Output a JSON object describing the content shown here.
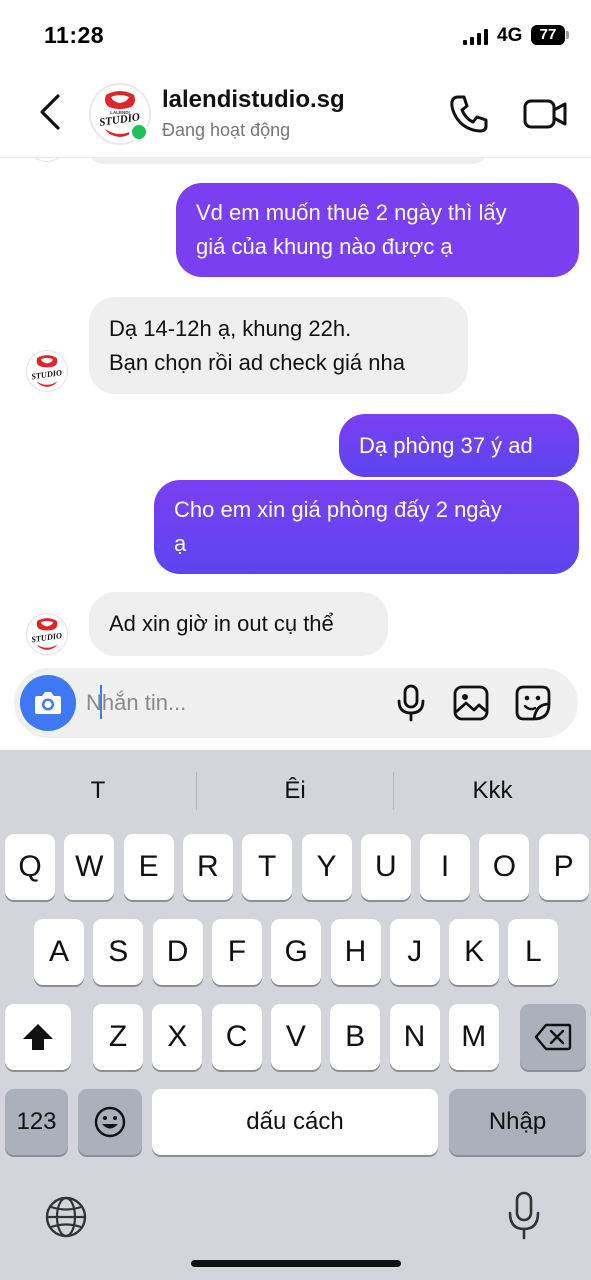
{
  "status_bar": {
    "time": "11:28",
    "network": "4G",
    "battery": "77"
  },
  "header": {
    "name": "lalendistudio.sg",
    "status": "Đang hoạt động"
  },
  "logo_text": {
    "top": "LALENDI",
    "main": "STUDIO"
  },
  "messages": [
    {
      "side": "sent",
      "lines": [
        "Vd em muốn thuê 2 ngày thì lấy",
        "giá của khung nào được ạ"
      ]
    },
    {
      "side": "received",
      "lines": [
        "Dạ 14-12h ạ, khung 22h.",
        "Bạn chọn rồi ad check giá nha"
      ]
    },
    {
      "side": "sent",
      "lines": [
        "Dạ phòng 37 ý ad"
      ]
    },
    {
      "side": "sent",
      "lines": [
        "Cho em xin giá phòng đấy 2 ngày",
        "ạ"
      ]
    },
    {
      "side": "received",
      "lines": [
        "Ad xin giờ in out cụ thể"
      ]
    }
  ],
  "composer": {
    "placeholder": "Nhắn tin..."
  },
  "keyboard": {
    "suggestions": [
      "T",
      "Êi",
      "Kkk"
    ],
    "row1": [
      "Q",
      "W",
      "E",
      "R",
      "T",
      "Y",
      "U",
      "I",
      "O",
      "P"
    ],
    "row2": [
      "A",
      "S",
      "D",
      "F",
      "G",
      "H",
      "J",
      "K",
      "L"
    ],
    "row3": [
      "Z",
      "X",
      "C",
      "V",
      "B",
      "N",
      "M"
    ],
    "numbers_key": "123",
    "space_key": "dấu cách",
    "return_key": "Nhập"
  },
  "colors": {
    "sent_top": "#7b3ff2",
    "sent_bottom": "#5b45f0",
    "received": "#efefef",
    "camera_button": "#3e78f2",
    "online": "#1ec05a",
    "keyboard": "#d3d5da"
  },
  "icons": {
    "back": "chevron-left-icon",
    "call": "phone-icon",
    "video": "video-camera-icon",
    "camera": "camera-icon",
    "mic": "microphone-icon",
    "gallery": "image-icon",
    "sticker": "sticker-icon",
    "shift": "shift-arrow-icon",
    "delete": "backspace-icon",
    "emoji": "emoji-icon",
    "globe": "globe-icon",
    "dictation": "dictation-mic-icon"
  }
}
